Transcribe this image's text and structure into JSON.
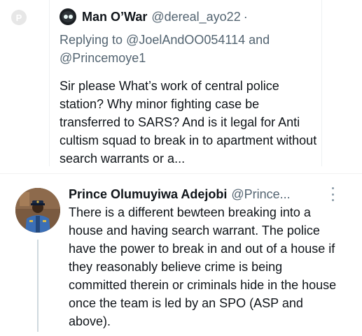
{
  "watermark": {
    "letter": "P"
  },
  "quoted_tweet": {
    "author_name": "Man O’War",
    "author_handle": "@dereal_ayo22",
    "separator": "·",
    "replying_prefix": "Replying to",
    "replying_mention_1": "@JoelAndOO054114",
    "replying_and": "and",
    "replying_mention_2": "@Princemoye1",
    "text": "Sir please What’s work of central police station? Why minor fighting case be transferred to SARS? And is it legal for Anti cultism squad to break in to apartment without search warrants or a..."
  },
  "reply_tweet": {
    "author_name": "Prince Olumuyiwa Adejobi",
    "author_handle": "@Prince...",
    "text": "There is a different bewteen breaking into a house and having search warrant. The police have the power to break in and out of a house if they reasonably believe crime is being committed therein or criminals hide in the house once the team is led by an SPO (ASP and above)."
  },
  "icons": {
    "watermark": "pinterest-logo-icon",
    "more": "more-vertical-icon",
    "avatar_1": "masked-avatar-icon",
    "avatar_2": "police-officer-photo"
  },
  "colors": {
    "text_primary": "#0f1419",
    "text_secondary": "#536471",
    "thread_line": "#cfd9de",
    "uniform_blue": "#3b6fb6"
  }
}
